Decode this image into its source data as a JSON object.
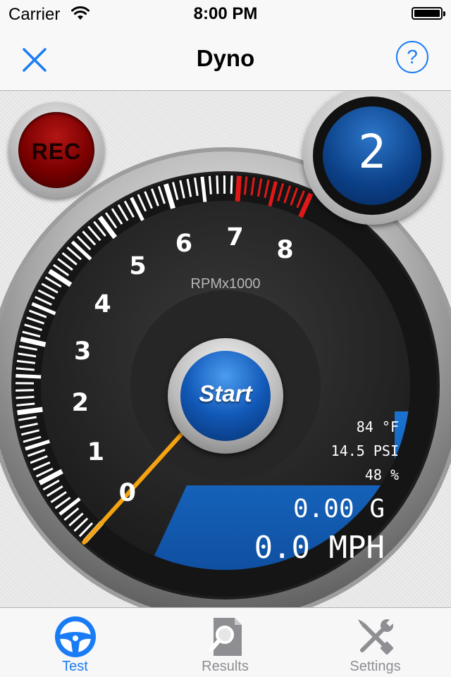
{
  "status_bar": {
    "carrier": "Carrier",
    "time": "8:00 PM"
  },
  "nav": {
    "title": "Dyno",
    "help_label": "?"
  },
  "rec_button": {
    "label": "REC"
  },
  "gear": {
    "value": "2"
  },
  "gauge": {
    "unit_label": "RPMx1000",
    "numbers": [
      "0",
      "1",
      "2",
      "3",
      "4",
      "5",
      "6",
      "7",
      "8"
    ],
    "rpm_thousands": 0,
    "start_label": "Start"
  },
  "readouts": {
    "temperature": "84 °F",
    "pressure": "14.5 PSI",
    "humidity": "48 %",
    "g_force": "0.00 G",
    "speed": "0.0 MPH"
  },
  "tabs": [
    {
      "label": "Test",
      "icon": "steering-wheel-icon",
      "active": true
    },
    {
      "label": "Results",
      "icon": "magnifier-document-icon",
      "active": false
    },
    {
      "label": "Settings",
      "icon": "wrench-screwdriver-icon",
      "active": false
    }
  ],
  "colors": {
    "accent": "#1a7cf5",
    "inactive": "#8e8e93",
    "redline": "#e01818",
    "needle": "#f5a311",
    "panel": "#1566c4"
  }
}
